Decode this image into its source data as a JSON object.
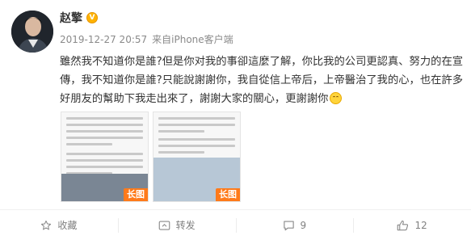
{
  "user": {
    "name": "赵擎",
    "verified_mark": "V"
  },
  "post": {
    "timestamp": "2019-12-27 20:57",
    "source_prefix": "来自",
    "source": "iPhone客户端",
    "text_1": "雖然我不知道你是誰?但是你对我的事卻這麼了解，你比我的公司更認真、努力的在宣傳，我不知道你是誰?只能說謝謝你，我自從信上帝后，上帝醫治了我的心，也在許多好朋友的幫助下我走出來了，謝謝大家的關心，更謝謝你",
    "emoji_icon": "smile-icon"
  },
  "thumbnails": [
    {
      "badge": "长图"
    },
    {
      "badge": "长图"
    }
  ],
  "actions": {
    "favorite_label": "收藏",
    "repost_label": "转发",
    "comment_count": "9",
    "like_count": "12"
  },
  "colors": {
    "badge": "#ff7a1a",
    "verified": "#ffb300",
    "meta_text": "#8a8a8a"
  }
}
